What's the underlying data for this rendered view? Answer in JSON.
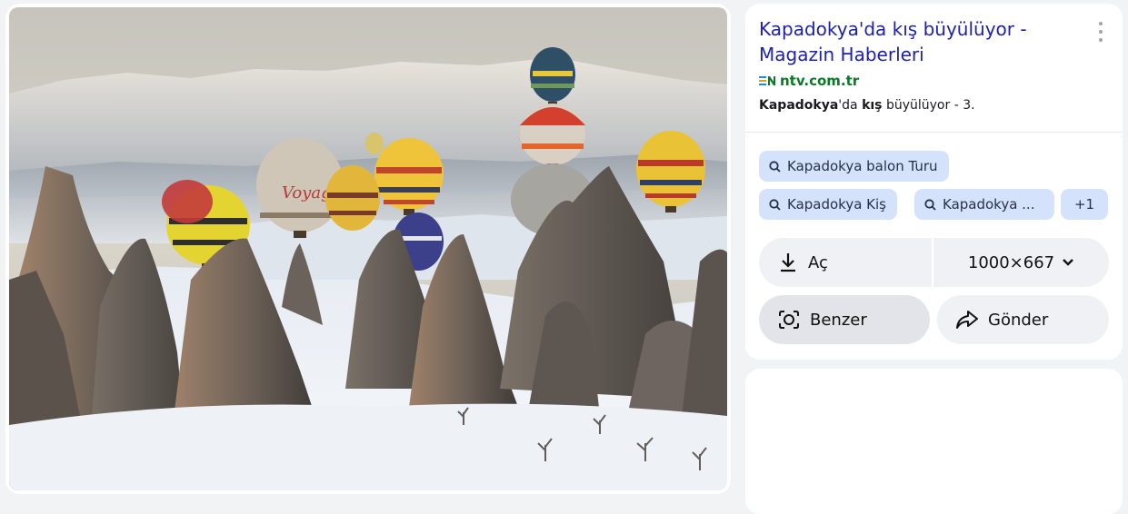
{
  "result": {
    "title": "Kapadokya'da kış büyülüyor - Magazin Haberleri",
    "source": {
      "name": "ntv.com.tr",
      "icon": "ntv-logo-icon"
    },
    "snippet": {
      "bold1": "Kapadokya",
      "mid": "'da ",
      "bold2": "kış",
      "rest": " büyülüyor - 3."
    },
    "more_icon": "kebab-menu-icon"
  },
  "chips": [
    {
      "label": "Kapadokya balon Turu",
      "icon": "search-icon"
    },
    {
      "label": "Kapadokya Kiş",
      "icon": "search-icon"
    },
    {
      "label": "Kapadokya ...",
      "icon": "search-icon"
    },
    {
      "label": "+1"
    }
  ],
  "actions": {
    "open_label": "Aç",
    "size_label": "1000×667",
    "similar_label": "Benzer",
    "send_label": "Gönder"
  },
  "colors": {
    "title_link": "#1f22a8",
    "source_green": "#0b7a26",
    "chip_bg": "#d5e2fb"
  }
}
